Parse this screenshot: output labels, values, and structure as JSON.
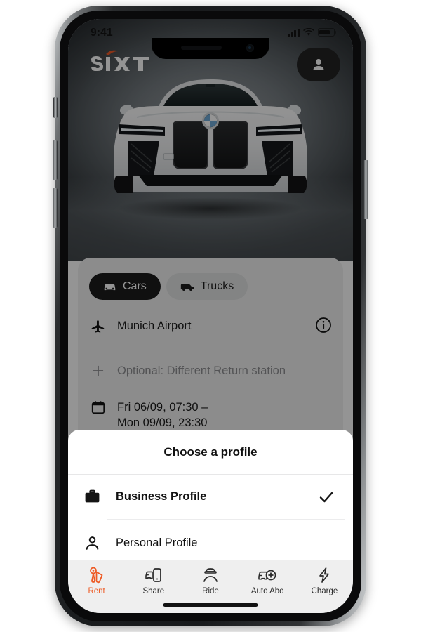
{
  "status_bar": {
    "time": "9:41",
    "signal_icon": "cellular-bars-icon",
    "wifi_icon": "wifi-icon",
    "battery_icon": "battery-icon"
  },
  "header": {
    "brand": "SiXT",
    "brand_accent_color": "#f05a28",
    "avatar_icon": "person-icon"
  },
  "hero": {
    "car_alt": "white-bmw-ix-suv-front-view"
  },
  "search_card": {
    "segments": [
      {
        "label": "Cars",
        "icon": "car-icon",
        "active": true
      },
      {
        "label": "Trucks",
        "icon": "truck-icon",
        "active": false
      }
    ],
    "pickup_station": {
      "icon": "airplane-icon",
      "value": "Munich Airport",
      "info_icon": "info-circle-icon"
    },
    "return_station": {
      "icon": "plus-icon",
      "placeholder": "Optional: Different Return station",
      "value": ""
    },
    "dates": {
      "icon": "calendar-icon",
      "line1": "Fri 06/09, 07:30 –",
      "line2": "Mon 09/09, 23:30"
    }
  },
  "profile_sheet": {
    "title": "Choose a profile",
    "options": [
      {
        "label": "Business Profile",
        "icon": "briefcase-icon",
        "selected": true,
        "check_icon": "checkmark-icon"
      },
      {
        "label": "Personal Profile",
        "icon": "person-outline-icon",
        "selected": false
      }
    ]
  },
  "tab_bar": {
    "active_color": "#ee5a24",
    "items": [
      {
        "label": "Rent",
        "icon": "car-key-icon",
        "active": true
      },
      {
        "label": "Share",
        "icon": "car-phone-icon",
        "active": false
      },
      {
        "label": "Ride",
        "icon": "chauffeur-icon",
        "active": false
      },
      {
        "label": "Auto Abo",
        "icon": "car-plus-icon",
        "active": false
      },
      {
        "label": "Charge",
        "icon": "lightning-bolt-icon",
        "active": false
      }
    ]
  }
}
